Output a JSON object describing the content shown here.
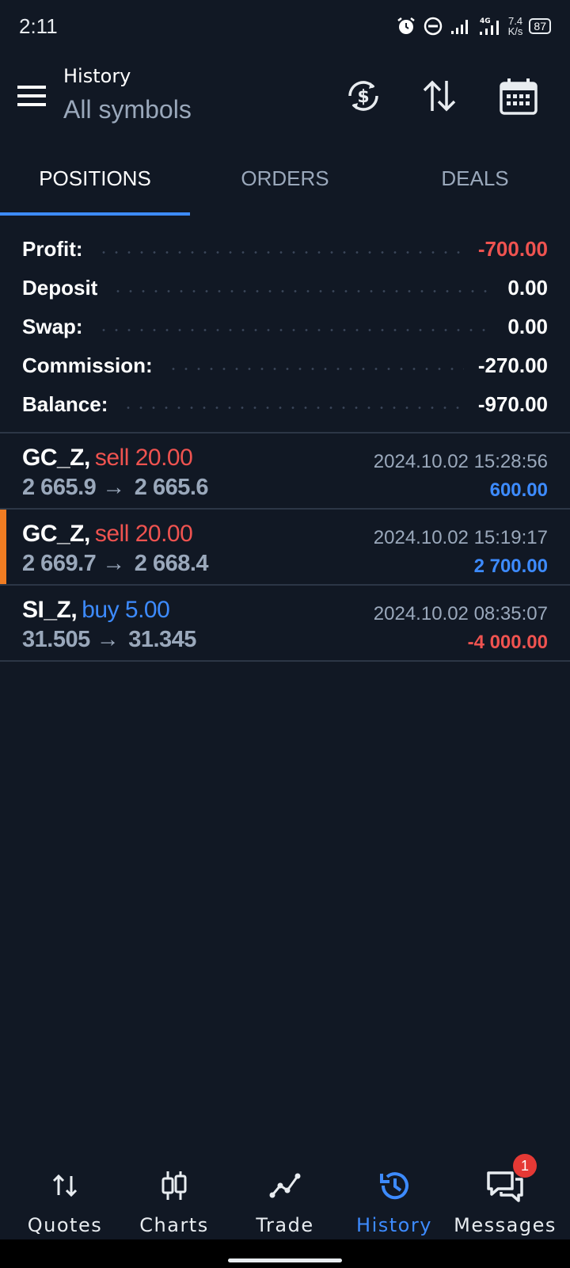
{
  "status": {
    "time": "2:11",
    "net_speed_top": "7.4",
    "net_speed_bottom": "K/s",
    "battery": "87"
  },
  "header": {
    "title": "History",
    "subtitle": "All symbols"
  },
  "tabs": [
    {
      "label": "POSITIONS"
    },
    {
      "label": "ORDERS"
    },
    {
      "label": "DEALS"
    }
  ],
  "summary": [
    {
      "label": "Profit:",
      "value": "-700.00"
    },
    {
      "label": "Deposit",
      "value": "0.00"
    },
    {
      "label": "Swap:",
      "value": "0.00"
    },
    {
      "label": "Commission:",
      "value": "-270.00"
    },
    {
      "label": "Balance:",
      "value": "-970.00"
    }
  ],
  "deals": [
    {
      "symbol": "GC_Z,",
      "side": "sell 20.00",
      "open": "2 665.9",
      "arrow": "→",
      "close": "2 665.6",
      "time": "2024.10.02 15:28:56",
      "profit": "600.00"
    },
    {
      "symbol": "GC_Z,",
      "side": "sell 20.00",
      "open": "2 669.7",
      "arrow": "→",
      "close": "2 668.4",
      "time": "2024.10.02 15:19:17",
      "profit": "2 700.00"
    },
    {
      "symbol": "SI_Z,",
      "side": "buy 5.00",
      "open": "31.505",
      "arrow": "→",
      "close": "31.345",
      "time": "2024.10.02 08:35:07",
      "profit": "-4 000.00"
    }
  ],
  "nav": [
    {
      "label": "Quotes"
    },
    {
      "label": "Charts"
    },
    {
      "label": "Trade"
    },
    {
      "label": "History"
    },
    {
      "label": "Messages",
      "badge": "1"
    }
  ],
  "colors": {
    "background": "#111824",
    "accent": "#3d8bff",
    "negative": "#ef5350",
    "muted": "#9aa8bb",
    "selected_marker": "#f07c22"
  }
}
